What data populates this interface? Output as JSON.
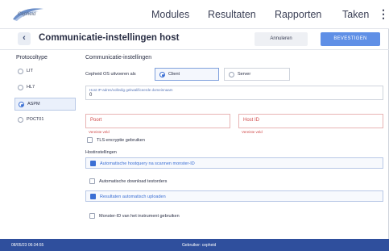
{
  "header": {
    "logo_text": "Cepheid",
    "nav": [
      "Modules",
      "Resultaten",
      "Rapporten",
      "Taken"
    ],
    "more_icon": "kebab-vertical-icon"
  },
  "titlebar": {
    "title": "Communicatie-instellingen host",
    "cancel_label": "Annuleren",
    "confirm_label": "BEVESTIGEN"
  },
  "protocol": {
    "header": "Protocoltype",
    "items": [
      {
        "label": "LIT",
        "selected": false
      },
      {
        "label": "HL7",
        "selected": false
      },
      {
        "label": "ASPM",
        "selected": true
      },
      {
        "label": "POCT01",
        "selected": false
      }
    ]
  },
  "settings": {
    "header": "Communicatie-instellingen",
    "run_as_label": "Cepheid OS uitvoeren als",
    "client_label": "Client",
    "server_label": "Server",
    "host_field_label": "Host IP-adres/volledig gekwalificeerde domeinnaam",
    "host_field_value": "0",
    "port_label": "Poort",
    "port_error": "Vereiste veld",
    "host_id_label": "Host ID",
    "host_id_error": "Vereiste veld",
    "tls_label": "TLS-encryptie gebruiken"
  },
  "host_settings": {
    "header": "Hostinstellingen",
    "items": [
      {
        "label": "Automatische hostquery na scannen monster-ID",
        "checked": true
      },
      {
        "label": "Automatische download testorders",
        "checked": false
      },
      {
        "label": "Resultaten automatisch uploaden",
        "checked": true
      },
      {
        "label": "Monster-ID van het instrument gebruiken",
        "checked": false
      }
    ]
  },
  "footer": {
    "timestamp": "08/05/23 06:34:55",
    "user": "Gebruiker: cepheid"
  },
  "colors": {
    "accent": "#3b6fd4",
    "confirm": "#5f8fe6",
    "footer": "#2f4f9d",
    "error": "#d04a4a"
  }
}
